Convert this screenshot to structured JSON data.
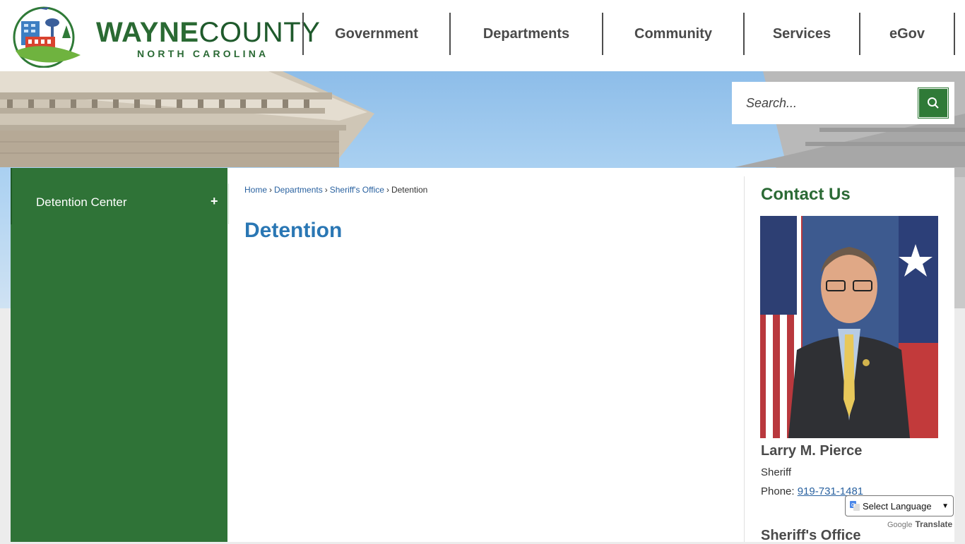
{
  "brand": {
    "name_part1": "WAYNE",
    "name_part2": "COUNTY",
    "subtitle": "NORTH CAROLINA"
  },
  "nav": {
    "items": [
      {
        "label": "Government",
        "width": 208
      },
      {
        "label": "Departments",
        "width": 216
      },
      {
        "label": "Community",
        "width": 200
      },
      {
        "label": "Services",
        "width": 164
      },
      {
        "label": "eGov",
        "width": 134
      }
    ]
  },
  "search": {
    "placeholder": "Search...",
    "icon": "search-icon"
  },
  "sidebar": {
    "items": [
      {
        "label": "Detention Center",
        "toggle": "+"
      }
    ]
  },
  "breadcrumb": {
    "items": [
      "Home",
      "Departments",
      "Sheriff's Office"
    ],
    "current": "Detention",
    "separator": "›"
  },
  "page": {
    "title": "Detention"
  },
  "contact": {
    "heading": "Contact Us",
    "name": "Larry M. Pierce",
    "role": "Sheriff",
    "phone_label": "Phone: ",
    "phone": "919-731-1481",
    "office_heading": "Sheriff's Office"
  },
  "translate": {
    "select_label": "Select Language",
    "powered_by": "Google",
    "translate_label": "Translate"
  },
  "colors": {
    "brand_green": "#2f7337",
    "title_blue": "#2a77b4",
    "link_blue": "#2a62a0"
  }
}
